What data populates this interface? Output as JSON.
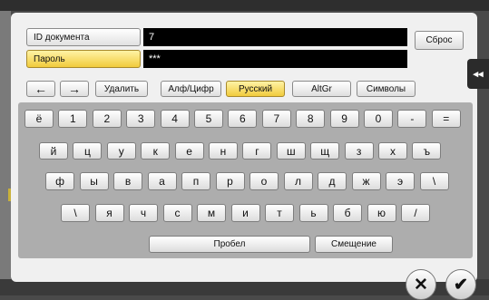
{
  "form": {
    "doc_id_label": "ID документа",
    "doc_id_value": "7",
    "password_label": "Пароль",
    "password_value": "***",
    "reset_label": "Сброс"
  },
  "toolbar": {
    "left_arrow": "←",
    "right_arrow": "→",
    "delete_label": "Удалить",
    "alnum_label": "Алф/Цифр",
    "russian_label": "Русский",
    "altgr_label": "AltGr",
    "symbols_label": "Символы"
  },
  "keyboard": {
    "row1": [
      "ё",
      "1",
      "2",
      "3",
      "4",
      "5",
      "6",
      "7",
      "8",
      "9",
      "0",
      "-",
      "="
    ],
    "row2": [
      "й",
      "ц",
      "у",
      "к",
      "е",
      "н",
      "г",
      "ш",
      "щ",
      "з",
      "х",
      "ъ"
    ],
    "row3": [
      "ф",
      "ы",
      "в",
      "а",
      "п",
      "р",
      "о",
      "л",
      "д",
      "ж",
      "э",
      "\\"
    ],
    "row4": [
      "\\",
      "я",
      "ч",
      "с",
      "м",
      "и",
      "т",
      "ь",
      "б",
      "ю",
      "/"
    ],
    "space_label": "Пробел",
    "shift_label": "Смещение"
  },
  "side_tab": {
    "icon": "double-chevron-left-icon",
    "glyph": "◂◂"
  },
  "actions": {
    "cancel_icon": "close-icon",
    "cancel_glyph": "✕",
    "ok_icon": "checkmark-icon",
    "ok_glyph": "✔"
  },
  "colors": {
    "active_yellow": "#f1cb3c",
    "field_black": "#000000",
    "keyboard_bg": "#adadad"
  }
}
